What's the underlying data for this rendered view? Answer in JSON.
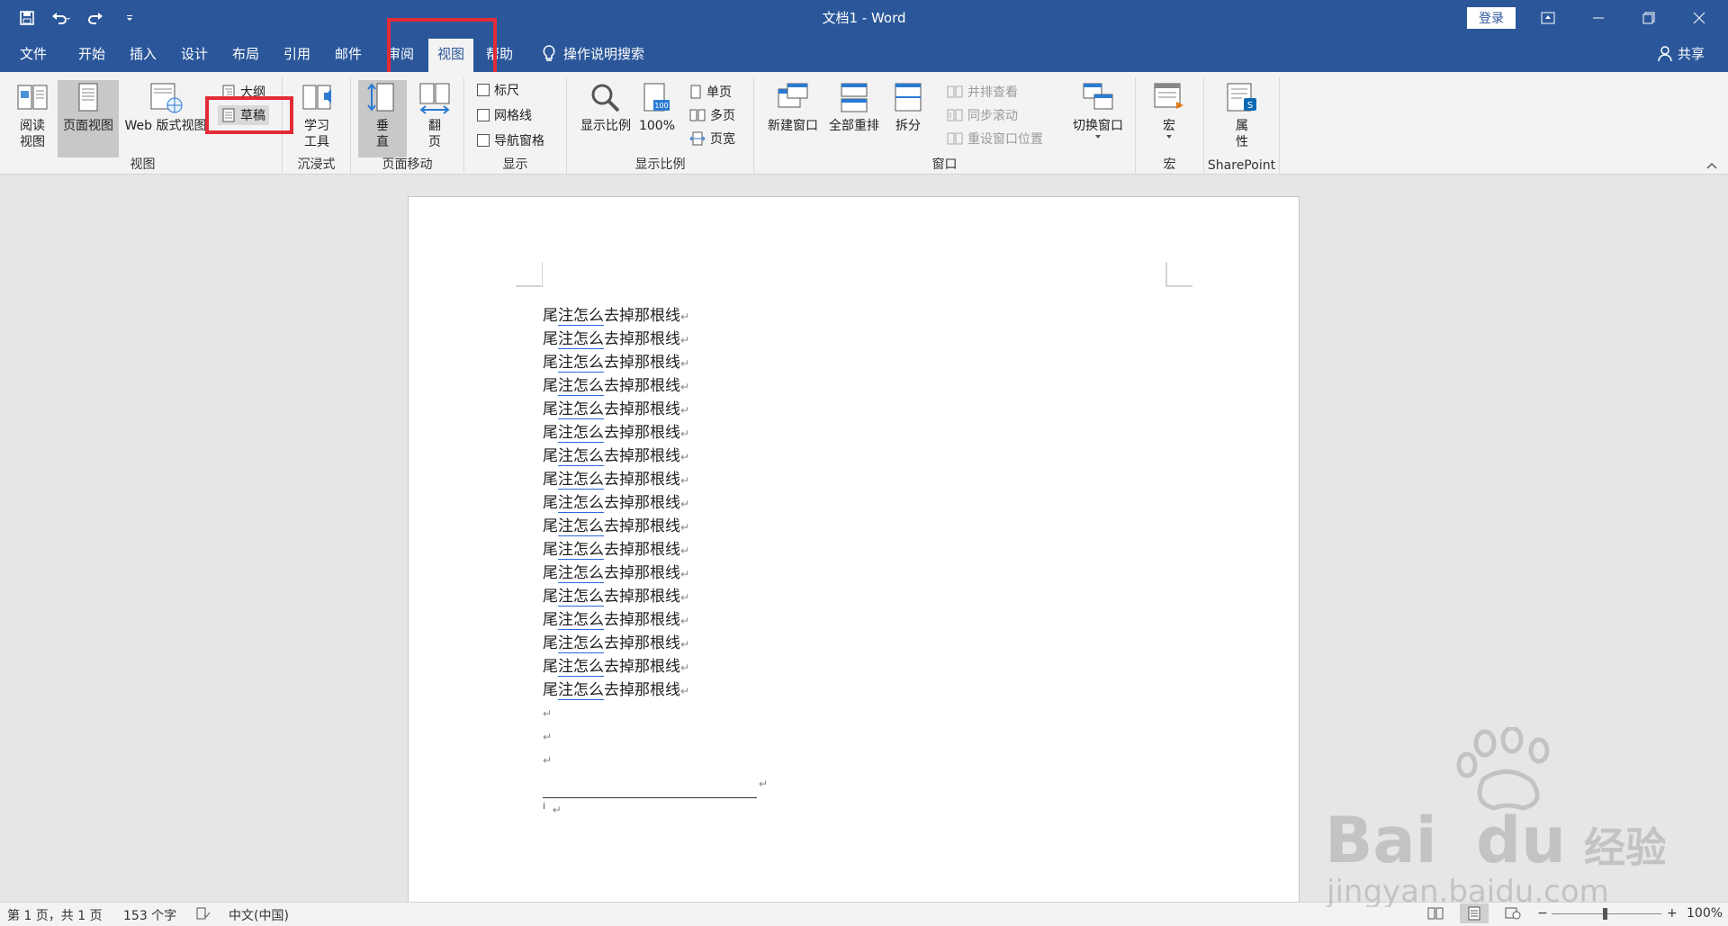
{
  "titlebar": {
    "doc_title": "文档1 - Word",
    "login_label": "登录",
    "qat": [
      "save-icon",
      "undo-icon",
      "redo-icon",
      "customize-icon"
    ]
  },
  "menu": {
    "tabs": [
      "文件",
      "开始",
      "插入",
      "设计",
      "布局",
      "引用",
      "邮件",
      "审阅",
      "视图",
      "帮助"
    ],
    "active_tab": "视图",
    "tellme": "操作说明搜索",
    "share": "共享"
  },
  "ribbon": {
    "views": {
      "label": "视图",
      "read_mode": [
        "阅读",
        "视图"
      ],
      "print_layout": "页面视图",
      "web_layout": "Web 版式视图",
      "outline": "大纲",
      "draft": "草稿"
    },
    "immersive": {
      "label": "沉浸式",
      "learning_tools": [
        "学习",
        "工具"
      ]
    },
    "page_movement": {
      "label": "页面移动",
      "vertical": [
        "垂",
        "直"
      ],
      "side_to_side": [
        "翻",
        "页"
      ]
    },
    "show": {
      "label": "显示",
      "ruler": "标尺",
      "gridlines": "网格线",
      "nav_pane": "导航窗格"
    },
    "zoom": {
      "label": "显示比例",
      "zoom": "显示比例",
      "hundred": "100%",
      "one_page": "单页",
      "multi_page": "多页",
      "page_width": "页宽"
    },
    "window": {
      "label": "窗口",
      "new_window": "新建窗口",
      "arrange_all": "全部重排",
      "split": "拆分",
      "side_by_side": "并排查看",
      "sync_scroll": "同步滚动",
      "reset_pos": "重设窗口位置",
      "switch_windows": "切换窗口"
    },
    "macros": {
      "label": "宏",
      "macros": "宏"
    },
    "sharepoint": {
      "label": "SharePoint",
      "properties": [
        "属",
        "性"
      ]
    }
  },
  "document": {
    "line_parts": [
      "尾",
      "注怎么",
      "去掉那根线"
    ],
    "line_count": 17,
    "empty_paragraphs": 3,
    "para_mark": "↵",
    "footnote_mark": "i"
  },
  "status": {
    "page": "第 1 页，共 1 页",
    "words": "153 个字",
    "language": "中文(中国)",
    "zoom_minus": "−",
    "zoom_plus": "+",
    "zoom": "100%"
  },
  "colors": {
    "accent": "#2b579a",
    "highlight": "#e32b35"
  }
}
